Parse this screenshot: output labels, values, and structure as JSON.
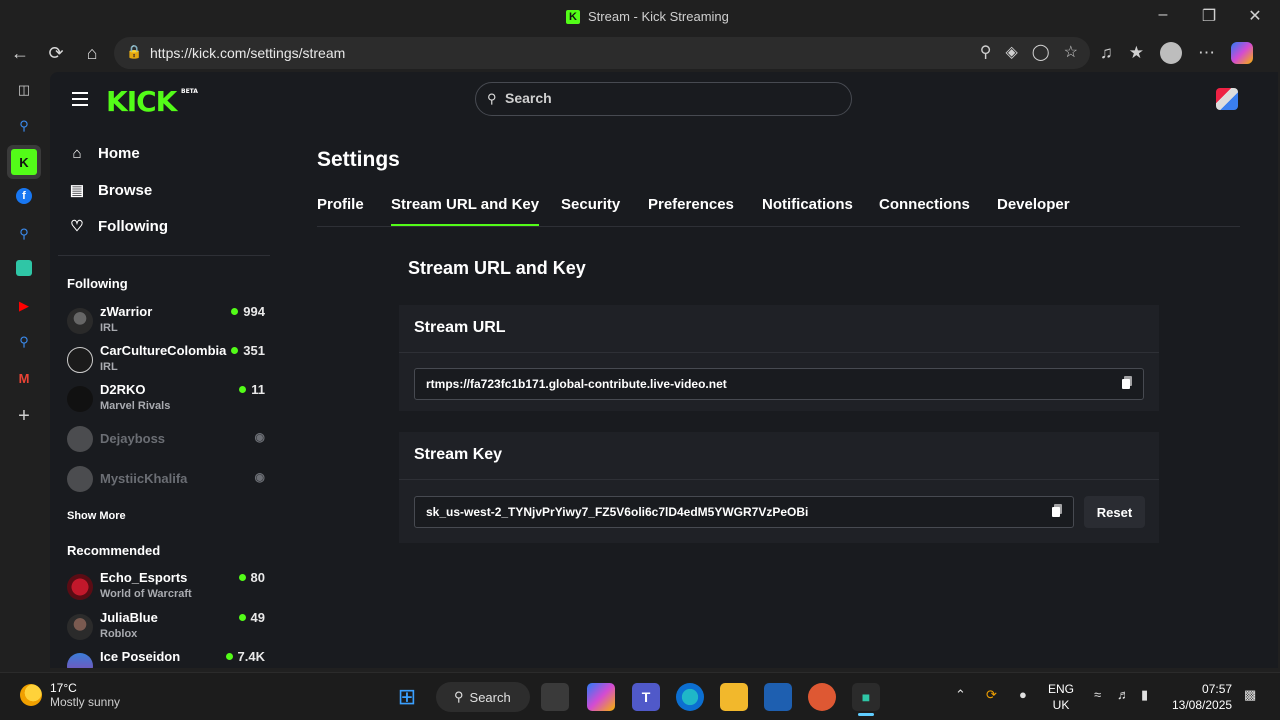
{
  "window": {
    "title": "Stream - Kick Streaming"
  },
  "browser": {
    "url": "https://kick.com/settings/stream"
  },
  "header": {
    "search_placeholder": "Search"
  },
  "sidebar": {
    "nav": [
      {
        "label": "Home",
        "icon": "home-icon"
      },
      {
        "label": "Browse",
        "icon": "browse-icon"
      },
      {
        "label": "Following",
        "icon": "heart-icon"
      }
    ],
    "following_heading": "Following",
    "following": [
      {
        "name": "zWarrior",
        "category": "IRL",
        "viewers": "994",
        "live": true
      },
      {
        "name": "CarCultureColombia",
        "category": "IRL",
        "viewers": "351",
        "live": true
      },
      {
        "name": "D2RKO",
        "category": "Marvel Rivals",
        "viewers": "11",
        "live": true
      },
      {
        "name": "Dejayboss",
        "category": "",
        "viewers": "",
        "live": false
      },
      {
        "name": "MystiicKhalifa",
        "category": "",
        "viewers": "",
        "live": false
      }
    ],
    "show_more": "Show More",
    "recommended_heading": "Recommended",
    "recommended": [
      {
        "name": "Echo_Esports",
        "category": "World of Warcraft",
        "viewers": "80"
      },
      {
        "name": "JuliaBlue",
        "category": "Roblox",
        "viewers": "49"
      },
      {
        "name": "Ice Poseidon",
        "category": "",
        "viewers": "7.4K"
      }
    ]
  },
  "settings": {
    "title": "Settings",
    "tabs": [
      "Profile",
      "Stream URL and Key",
      "Security",
      "Preferences",
      "Notifications",
      "Connections",
      "Developer"
    ],
    "active_tab": "Stream URL and Key",
    "section_title": "Stream URL and Key",
    "stream_url_label": "Stream URL",
    "stream_url_value": "rtmps://fa723fc1b171.global-contribute.live-video.net",
    "stream_key_label": "Stream Key",
    "stream_key_value": "sk_us-west-2_TYNjvPrYiwy7_FZ5V6oli6c7lD4edM5YWGR7VzPeOBi",
    "reset_label": "Reset"
  },
  "taskbar": {
    "weather_temp": "17°C",
    "weather_desc": "Mostly sunny",
    "search_label": "Search",
    "lang_line1": "ENG",
    "lang_line2": "UK",
    "time": "07:57",
    "date": "13/08/2025"
  },
  "colors": {
    "accent": "#53fc18",
    "page_bg": "#191b1f",
    "card_bg": "#1f2126"
  }
}
